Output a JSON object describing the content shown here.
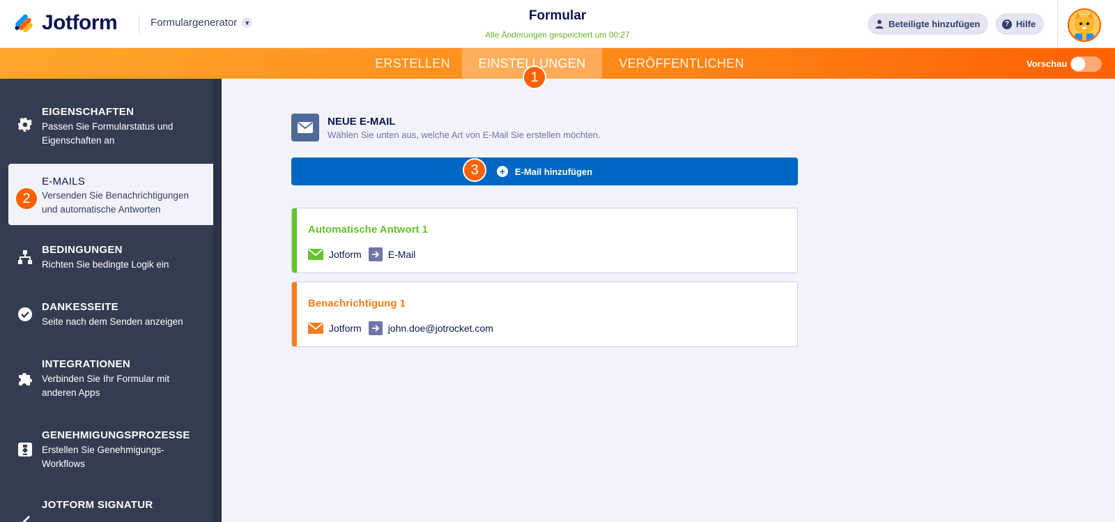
{
  "header": {
    "brand": "Jotform",
    "builder_dropdown": "Formulargenerator",
    "form_title": "Formular",
    "save_status": "Alle Änderungen gespeichert um 00:27",
    "invite_label": "Beteiligte hinzufügen",
    "help_label": "Hilfe"
  },
  "nav": {
    "tabs": [
      {
        "label": "ERSTELLEN"
      },
      {
        "label": "EINSTELLUNGEN",
        "active": true
      },
      {
        "label": "VERÖFFENTLICHEN"
      }
    ],
    "preview_label": "Vorschau",
    "preview_on": false
  },
  "badges": [
    "1",
    "2",
    "3"
  ],
  "sidebar": {
    "items": [
      {
        "title": "EIGENSCHAFTEN",
        "desc": "Passen Sie Formularstatus und Eigenschaften an",
        "icon": "gear-icon"
      },
      {
        "title": "E-MAILS",
        "desc": "Versenden Sie Benachrichtigungen und automatische Antworten",
        "icon": "envelope-icon",
        "active": true
      },
      {
        "title": "BEDINGUNGEN",
        "desc": "Richten Sie bedingte Logik ein",
        "icon": "hierarchy-icon"
      },
      {
        "title": "DANKESSEITE",
        "desc": "Seite nach dem Senden anzeigen",
        "icon": "check-circle-icon"
      },
      {
        "title": "INTEGRATIONEN",
        "desc": "Verbinden Sie Ihr Formular mit anderen Apps",
        "icon": "puzzle-icon"
      },
      {
        "title": "GENEHMIGUNGSPROZESSE",
        "desc": "Erstellen Sie Genehmigungs-Workflows",
        "icon": "workflow-icon"
      },
      {
        "title": "JOTFORM SIGNATUR",
        "desc": "",
        "icon": "signature-icon"
      }
    ]
  },
  "main": {
    "new_email_title": "NEUE E-MAIL",
    "new_email_sub": "Wählen Sie unten aus, welche Art von E-Mail Sie erstellen möchten.",
    "add_button": "E-Mail hinzufügen",
    "emails": [
      {
        "title": "Automatische Antwort 1",
        "from": "Jotform",
        "to": "E-Mail",
        "color": "#64c32a"
      },
      {
        "title": "Benachrichtigung 1",
        "from": "Jotform",
        "to": "john.doe@jotrocket.com",
        "color": "#ff7b1c"
      }
    ]
  },
  "colors": {
    "accent_orange": "#ff6100",
    "primary_blue": "#0066c3",
    "sidebar_bg": "#343c51"
  }
}
